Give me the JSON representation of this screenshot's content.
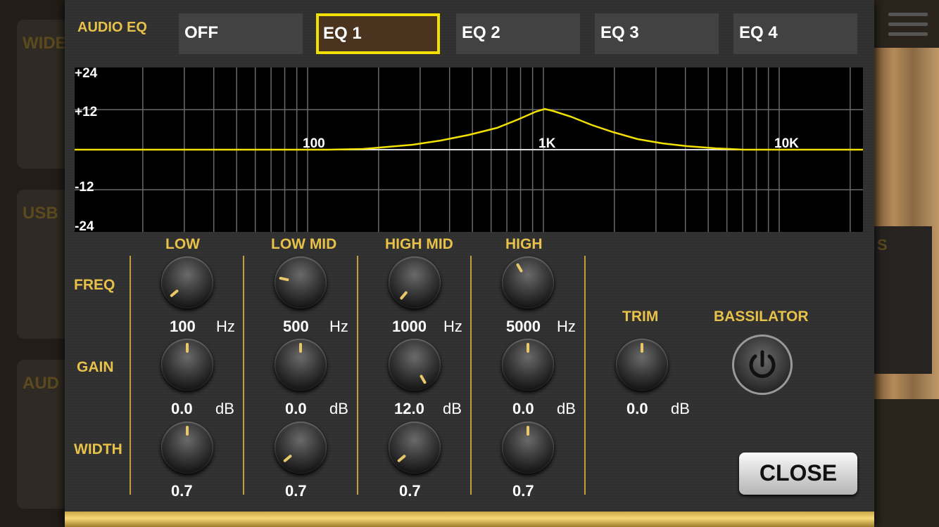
{
  "background": {
    "left_cards": [
      "WIDE",
      "USB",
      "AUD"
    ],
    "right_panel_text": "S"
  },
  "eq": {
    "title": "AUDIO EQ",
    "tabs": [
      {
        "label": "OFF",
        "active": false
      },
      {
        "label": "EQ 1",
        "active": true
      },
      {
        "label": "EQ 2",
        "active": false
      },
      {
        "label": "EQ 3",
        "active": false
      },
      {
        "label": "EQ 4",
        "active": false
      }
    ],
    "graph": {
      "y_labels": [
        "+24",
        "+12",
        "-12",
        "-24"
      ],
      "x_labels": [
        "100",
        "1K",
        "10K"
      ],
      "curve_color": "#f2e100"
    },
    "row_labels": {
      "freq": "FREQ",
      "gain": "GAIN",
      "width": "WIDTH"
    },
    "bands": [
      {
        "name": "LOW",
        "freq": "100",
        "freq_unit": "Hz",
        "gain": "0.0",
        "gain_unit": "dB",
        "width": "0.7"
      },
      {
        "name": "LOW MID",
        "freq": "500",
        "freq_unit": "Hz",
        "gain": "0.0",
        "gain_unit": "dB",
        "width": "0.7"
      },
      {
        "name": "HIGH MID",
        "freq": "1000",
        "freq_unit": "Hz",
        "gain": "12.0",
        "gain_unit": "dB",
        "width": "0.7"
      },
      {
        "name": "HIGH",
        "freq": "5000",
        "freq_unit": "Hz",
        "gain": "0.0",
        "gain_unit": "dB",
        "width": "0.7"
      }
    ],
    "trim": {
      "label": "TRIM",
      "value": "0.0",
      "unit": "dB"
    },
    "bassilator": {
      "label": "BASSILATOR"
    },
    "close_label": "CLOSE",
    "accent_color": "#e8c14a"
  }
}
